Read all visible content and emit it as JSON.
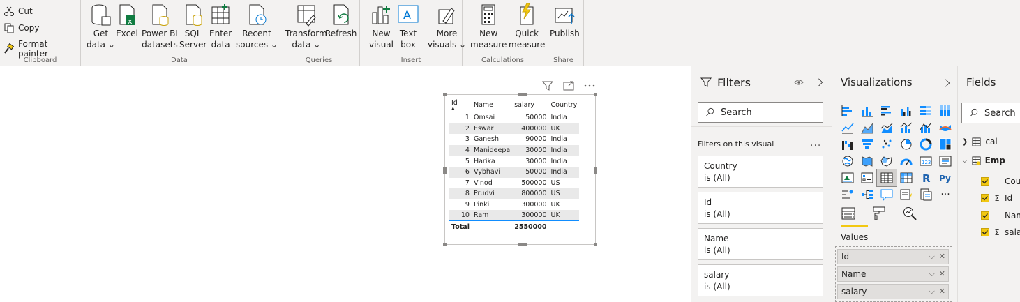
{
  "ribbon": {
    "clipboard": {
      "cut": "Cut",
      "copy": "Copy",
      "format_painter": "Format painter",
      "label": "Clipboard"
    },
    "data": {
      "label": "Data",
      "get_data": [
        "Get",
        "data ⌄"
      ],
      "excel": [
        "Excel"
      ],
      "powerbi": [
        "Power BI",
        "datasets"
      ],
      "sql": [
        "SQL",
        "Server"
      ],
      "enter": [
        "Enter",
        "data"
      ],
      "recent": [
        "Recent",
        "sources ⌄"
      ]
    },
    "queries": {
      "label": "Queries",
      "transform": [
        "Transform",
        "data ⌄"
      ],
      "refresh": [
        "Refresh"
      ]
    },
    "insert": {
      "label": "Insert",
      "new_visual": [
        "New",
        "visual"
      ],
      "text_box": [
        "Text",
        "box"
      ],
      "more_visuals": [
        "More",
        "visuals ⌄"
      ]
    },
    "calculations": {
      "label": "Calculations",
      "new_measure": [
        "New",
        "measure"
      ],
      "quick_measure": [
        "Quick",
        "measure"
      ]
    },
    "share": {
      "label": "Share",
      "publish": [
        "Publish"
      ]
    }
  },
  "table": {
    "headers": [
      "Id",
      "Name",
      "salary",
      "Country"
    ],
    "rows": [
      [
        "1",
        "Omsai",
        "50000",
        "India"
      ],
      [
        "2",
        "Eswar",
        "400000",
        "UK"
      ],
      [
        "3",
        "Ganesh",
        "90000",
        "India"
      ],
      [
        "4",
        "Manideepa",
        "30000",
        "India"
      ],
      [
        "5",
        "Harika",
        "30000",
        "India"
      ],
      [
        "6",
        "Vybhavi",
        "50000",
        "India"
      ],
      [
        "7",
        "Vinod",
        "500000",
        "US"
      ],
      [
        "8",
        "Prudvi",
        "800000",
        "US"
      ],
      [
        "9",
        "Pinki",
        "300000",
        "UK"
      ],
      [
        "10",
        "Ram",
        "300000",
        "UK"
      ]
    ],
    "total_label": "Total",
    "total_salary": "2550000"
  },
  "filters": {
    "title": "Filters",
    "search_placeholder": "Search",
    "section": "Filters on this visual",
    "more": "...",
    "cards": [
      {
        "field": "Country",
        "state": "is (All)"
      },
      {
        "field": "Id",
        "state": "is (All)"
      },
      {
        "field": "Name",
        "state": "is (All)"
      },
      {
        "field": "salary",
        "state": "is (All)"
      }
    ]
  },
  "visualizations": {
    "title": "Visualizations",
    "values_label": "Values",
    "fields": [
      "Id",
      "Name",
      "salary"
    ],
    "grid_r": "R",
    "grid_py": "Py",
    "grid_more": "···"
  },
  "fields_pane": {
    "title": "Fields",
    "search_placeholder": "Search",
    "tables": [
      "cal",
      "Emp"
    ],
    "emp_fields": [
      "Cou",
      "Id",
      "Nam",
      "sala"
    ]
  },
  "colors": {
    "accent_yellow": "#f2c811",
    "total_line": "#118dff",
    "pane_bg": "#f3f2f1"
  }
}
